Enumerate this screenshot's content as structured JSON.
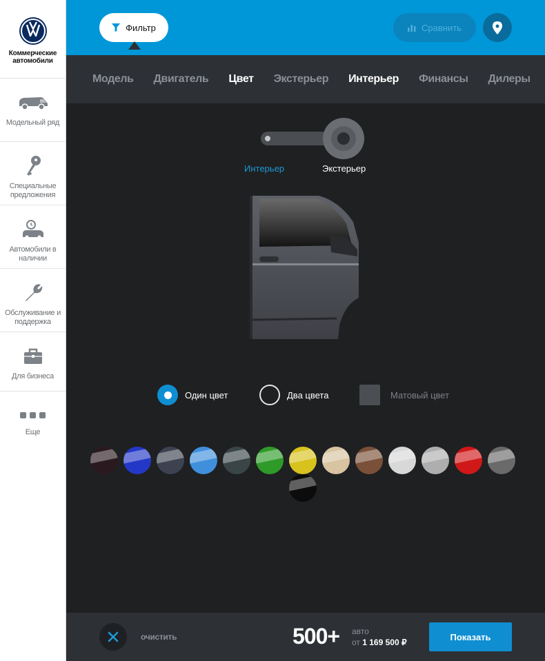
{
  "brand": {
    "name": "Коммерческие автомобили"
  },
  "sidebar": {
    "items": [
      {
        "label": "Модельный ряд",
        "icon": "van-icon"
      },
      {
        "label": "Специальные предложения",
        "icon": "keys-icon"
      },
      {
        "label": "Автомобили в наличии",
        "icon": "car-stock-icon"
      },
      {
        "label": "Обслуживание и поддержка",
        "icon": "wrench-icon"
      },
      {
        "label": "Для бизнеса",
        "icon": "briefcase-icon"
      },
      {
        "label": "Еще",
        "icon": "more-dots-icon"
      }
    ]
  },
  "header": {
    "filter_label": "Фильтр",
    "compare_label": "Сравнить"
  },
  "tabs": [
    {
      "label": "Модель",
      "active": false
    },
    {
      "label": "Двигатель",
      "active": false
    },
    {
      "label": "Цвет",
      "active": true
    },
    {
      "label": "Экстерьер",
      "active": false
    },
    {
      "label": "Интерьер",
      "active": true
    },
    {
      "label": "Финансы",
      "active": false
    },
    {
      "label": "Дилеры",
      "active": false
    }
  ],
  "view_toggle": {
    "left_label": "Интерьер",
    "right_label": "Экстерьер",
    "selected": "Экстерьер"
  },
  "color_types": [
    {
      "label": "Один цвет",
      "selected": true
    },
    {
      "label": "Два цвета",
      "selected": false
    },
    {
      "label": "Матовый цвет",
      "selected": false
    }
  ],
  "swatches": [
    "#2a1a1f",
    "#2438c8",
    "#3c4250",
    "#3f8fdc",
    "#3a4548",
    "#2e9a28",
    "#d8c21e",
    "#d8c4a0",
    "#7a5038",
    "#d8d8d8",
    "#aeaeae",
    "#d01818",
    "#6a6a6a",
    "#0c0c0c"
  ],
  "colors": {
    "accent": "#0097d9",
    "button": "#0f8fd2",
    "panel": "#2d3035",
    "background": "#1f2022"
  },
  "footer": {
    "clear_label": "очистить",
    "count": "500+",
    "count_unit": "авто",
    "price_prefix": "от",
    "price": "1 169 500 ₽",
    "show_label": "Показать"
  }
}
